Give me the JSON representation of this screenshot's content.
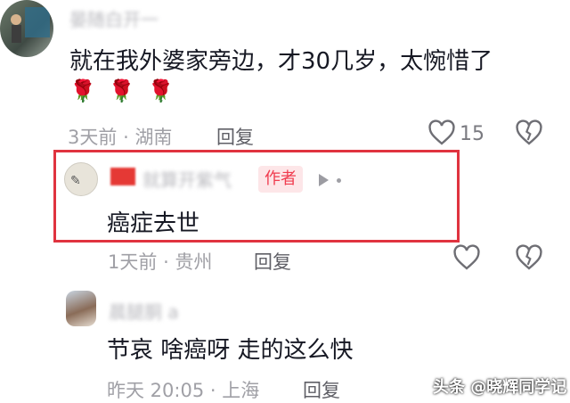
{
  "comments": [
    {
      "username": "晏随白开一",
      "text": "就在我外婆家旁边，才30几岁，太惋惜了",
      "emoji_name": "rose",
      "time": "3天前",
      "location": "湖南",
      "reply_label": "回复",
      "likes": "15"
    },
    {
      "username": "就算开紫气",
      "author_tag": "作者",
      "text": "癌症去世",
      "time": "1天前",
      "location": "贵州",
      "reply_label": "回复"
    },
    {
      "username": "晨腿胴 a",
      "text": "节哀 啥癌呀 走的这么快",
      "time": "昨天 20:05",
      "location": "上海",
      "reply_label": "回复"
    }
  ],
  "separator": "·",
  "watermark": "头条 @晓辉同学记",
  "colors": {
    "highlight_border": "#e0333f",
    "author_tag_bg": "#fde6e8",
    "author_tag_text": "#f03c4f"
  }
}
